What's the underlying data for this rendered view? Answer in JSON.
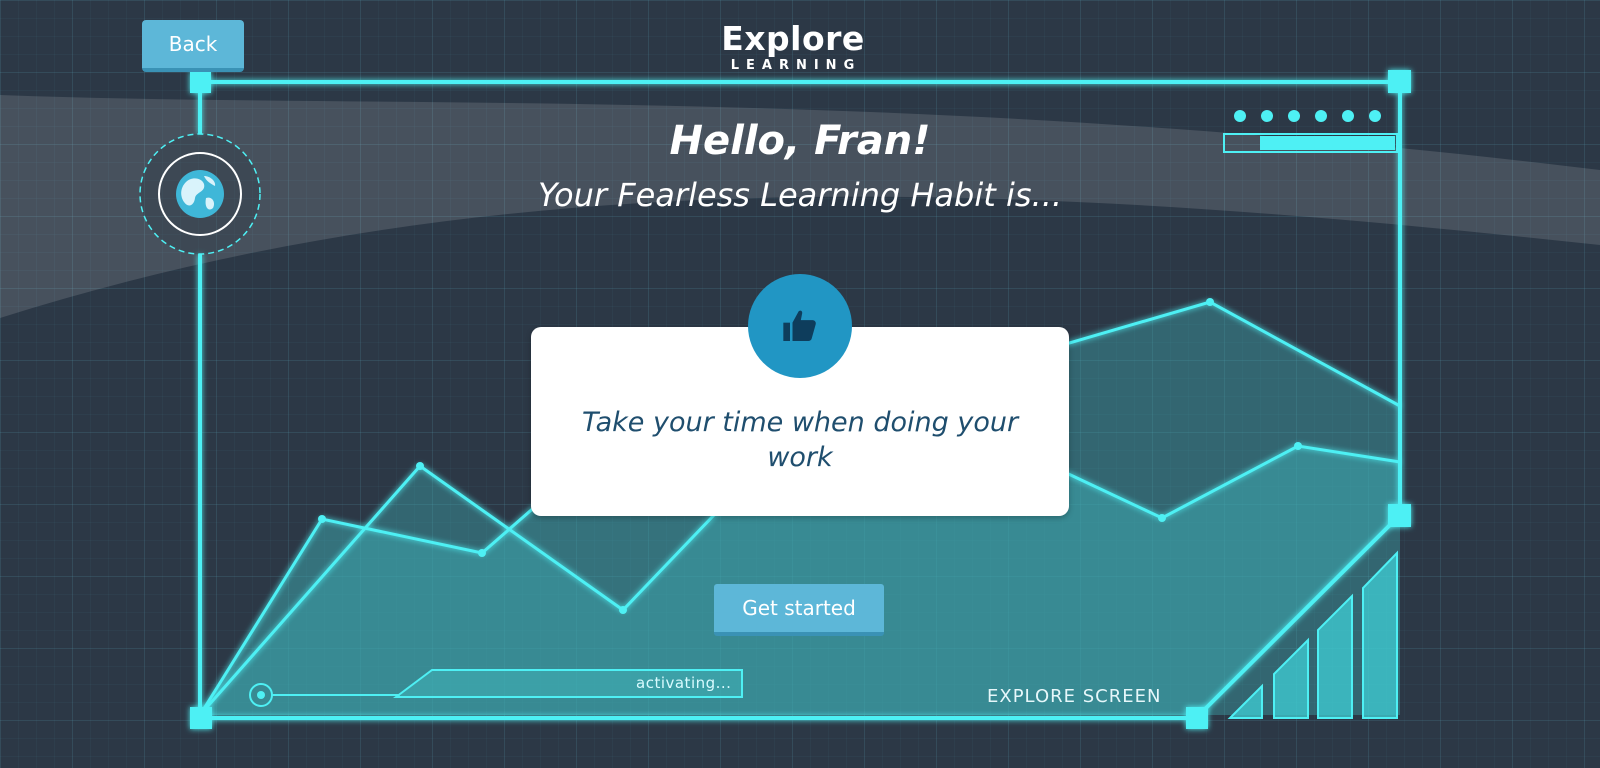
{
  "header": {
    "back_label": "Back",
    "logo_word": "Explore",
    "logo_sub": "LEARNING"
  },
  "main": {
    "greeting": "Hello, Fran!",
    "subtitle": "Your Fearless Learning Habit is...",
    "habit_icon": "thumbs-up-icon",
    "habit_text": "Take your time when doing your work",
    "start_label": "Get started"
  },
  "hud": {
    "status_text": "activating...",
    "footer_label": "EXPLORE SCREEN",
    "globe_icon": "globe-icon"
  },
  "colors": {
    "accent": "#4ef0f4",
    "button": "#5db7d8",
    "background": "#2c3846",
    "card_text": "#1f4e6e",
    "icon_circle": "#2196c4"
  }
}
